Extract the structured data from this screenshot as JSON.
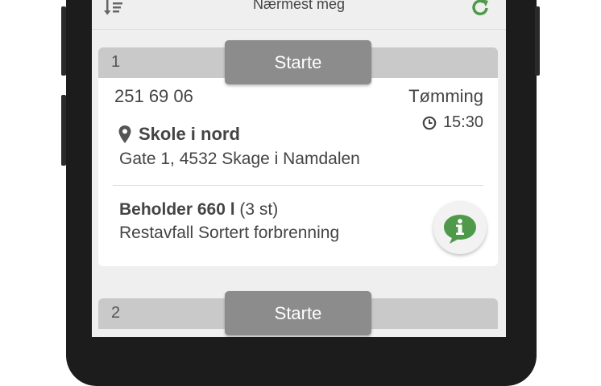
{
  "header": {
    "title": "Nærmest meg",
    "sort_icon": "sort-descending-icon",
    "refresh_icon": "refresh-icon"
  },
  "colors": {
    "accent_green": "#4f9a4a",
    "card_header": "#c9c9c9",
    "start_button": "#8c8c8c"
  },
  "jobs": [
    {
      "number": "1",
      "start_label": "Starte",
      "customer_number": "251 69 06",
      "job_type": "Tømming",
      "time": "15:30",
      "location_name": "Skole i nord",
      "address": "Gate 1, 4532 Skage i Namdalen",
      "container_name": "Beholder 660 l",
      "container_count": "(3 st)",
      "waste_type": "Restavfall Sortert forbrenning"
    },
    {
      "number": "2",
      "start_label": "Starte"
    }
  ]
}
